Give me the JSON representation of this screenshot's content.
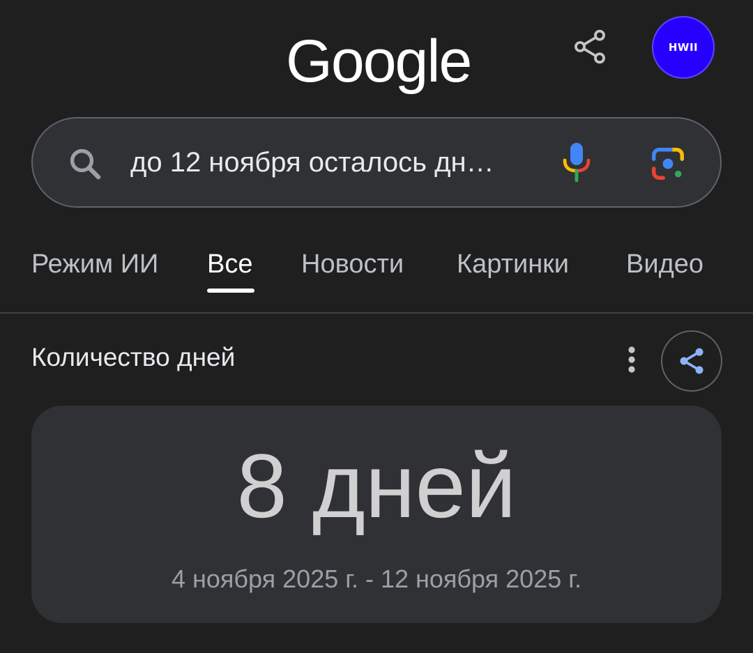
{
  "header": {
    "logo_text": "Google",
    "avatar_text": "HWII",
    "avatar_color": "#2600ff"
  },
  "search": {
    "query": "до 12 ноября осталось дн…",
    "icons": [
      "search-icon",
      "mic-icon",
      "lens-icon"
    ]
  },
  "tabs": [
    {
      "label": "Режим ИИ",
      "active": false
    },
    {
      "label": "Все",
      "active": true
    },
    {
      "label": "Новости",
      "active": false
    },
    {
      "label": "Картинки",
      "active": false
    },
    {
      "label": "Видео",
      "active": false
    }
  ],
  "card": {
    "title": "Количество дней",
    "result": "8 дней",
    "range": "4 ноября 2025 г. - 12 ноября 2025 г."
  },
  "colors": {
    "background": "#1f1f1f",
    "surface": "#303134",
    "accent_blue": "#8ab4f8"
  }
}
